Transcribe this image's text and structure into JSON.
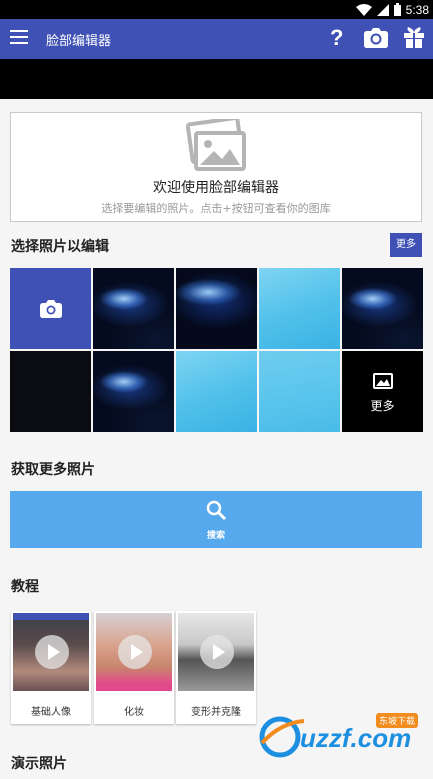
{
  "status_bar": {
    "time": "5:38"
  },
  "app_bar": {
    "title": "脸部编辑器",
    "help_label": "?",
    "accent_color": "#3f51b5"
  },
  "welcome": {
    "title": "欢迎使用脸部编辑器",
    "subtitle": "选择要编辑的照片。点击+按钮可查看你的图库"
  },
  "select_section": {
    "title": "选择照片以编辑",
    "more_button": "更多",
    "grid_more_label": "更多"
  },
  "get_more": {
    "title": "获取更多照片",
    "search_label": "搜索",
    "search_color": "#55a9ec"
  },
  "tutorials": {
    "title": "教程",
    "items": [
      {
        "label": "基础人像"
      },
      {
        "label": "化妆"
      },
      {
        "label": "变形并克隆"
      }
    ]
  },
  "demo": {
    "title": "演示照片"
  },
  "watermark": {
    "text": "uzzf.com",
    "badge": "东坡下载"
  }
}
